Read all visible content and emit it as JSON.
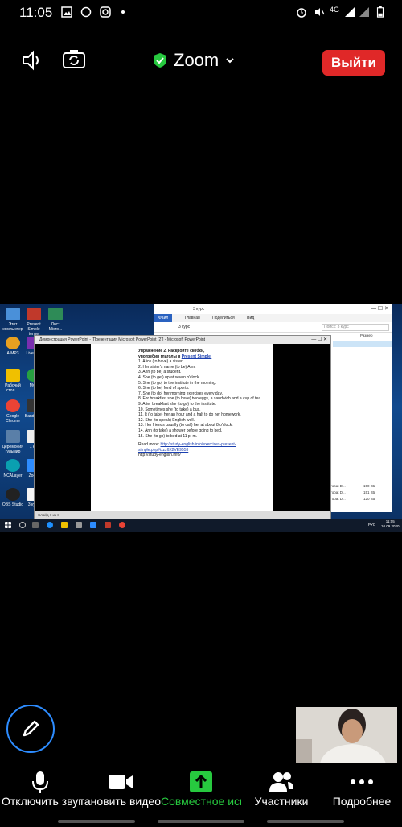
{
  "status_bar": {
    "time": "11:05",
    "network": "4G"
  },
  "topbar": {
    "title": "Zoom",
    "leave_label": "Выйти"
  },
  "desktop": {
    "icons": [
      "Этот компьютер",
      "Present Simple tense",
      "Лист Micro...",
      "AIMP3",
      "LiveInt...",
      "Рабочий стол ...",
      "My...",
      "Google Chrome",
      "Bandicam",
      "церемония гульмир",
      "1 к...",
      "NCALayer",
      "Zoom",
      "OBS Studio",
      "3 курс"
    ]
  },
  "explorer": {
    "title": "3 курс",
    "ribbon": [
      "Файл",
      "Главная",
      "Поделиться",
      "Вид"
    ],
    "address": "3 курс",
    "search_placeholder": "Поиск: 3 курс",
    "column_size": "Размер",
    "rows": [
      {
        "name": "Р10.01 - kk - 1010304122701",
        "date": "07.09.2020 14:54",
        "type": "Adobe Acrobat D...",
        "size": "150 КБ"
      },
      {
        "name": "Р10.01 - kk - 1010304043276",
        "date": "07.09.2020 14:54",
        "type": "Adobe Acrobat D...",
        "size": "151 КБ"
      },
      {
        "name": "Р10.01 - kk - 1010405812933",
        "date": "10.09.2020 9:12",
        "type": "Adobe Acrobat D...",
        "size": "120 КБ"
      }
    ],
    "status": "Элементов: 34"
  },
  "ppt": {
    "title": "Демонстрация PowerPoint - [Презентация Microsoft PowerPoint (2)] - Microsoft PowerPoint",
    "slide": {
      "heading1": "Упражнение 2. Раскройте скобки,",
      "heading2_pre": "употребив глаголы в ",
      "heading2_hl": "Present Simple.",
      "lines": [
        "1. Alice (to have) a sister.",
        "2. Her sister's name (to be) Ann.",
        "3. Ann (to be) a student.",
        "4. She (to get) up at seven o'clock.",
        "5. She (to go) to the institute in the morning.",
        "6. She (to be) fond of sports.",
        "7. She (to do) her morning exercises every day.",
        "8. For breakfast she (to have) two eggs, a sandwich and a cup of tea.",
        "9. After breakfast she (to go) to the institute.",
        "10. Sometimes she (to take) a bus.",
        "11. It (to take) her an hour and a half to do her homework.",
        "12. She (to speak) English well.",
        "13. Her friends usually (to call) her at about 8 o'clock.",
        "14. Ann (to take) a shower before going to bed.",
        "15. She (to go) to bed at 11 p. m."
      ],
      "read_more": "Read more: ",
      "link": "http://study-english.info/exercises-present-simple.php#ixzz6X2VE9553",
      "link2": "http://study-english.info/"
    },
    "status": "Слайд 7 из 8"
  },
  "taskbar": {
    "lang": "РУС",
    "time": "11:05",
    "date": "10.09.2020"
  },
  "toolbar": {
    "mute_label": "Отключить звук",
    "video_label": "Остановить видео",
    "share_label": "Совместное использование",
    "participants_label": "Участники",
    "more_label": "Подробнее"
  },
  "colors": {
    "leave": "#e02828",
    "share_green": "#27c93f",
    "accent": "#2d8cff"
  }
}
